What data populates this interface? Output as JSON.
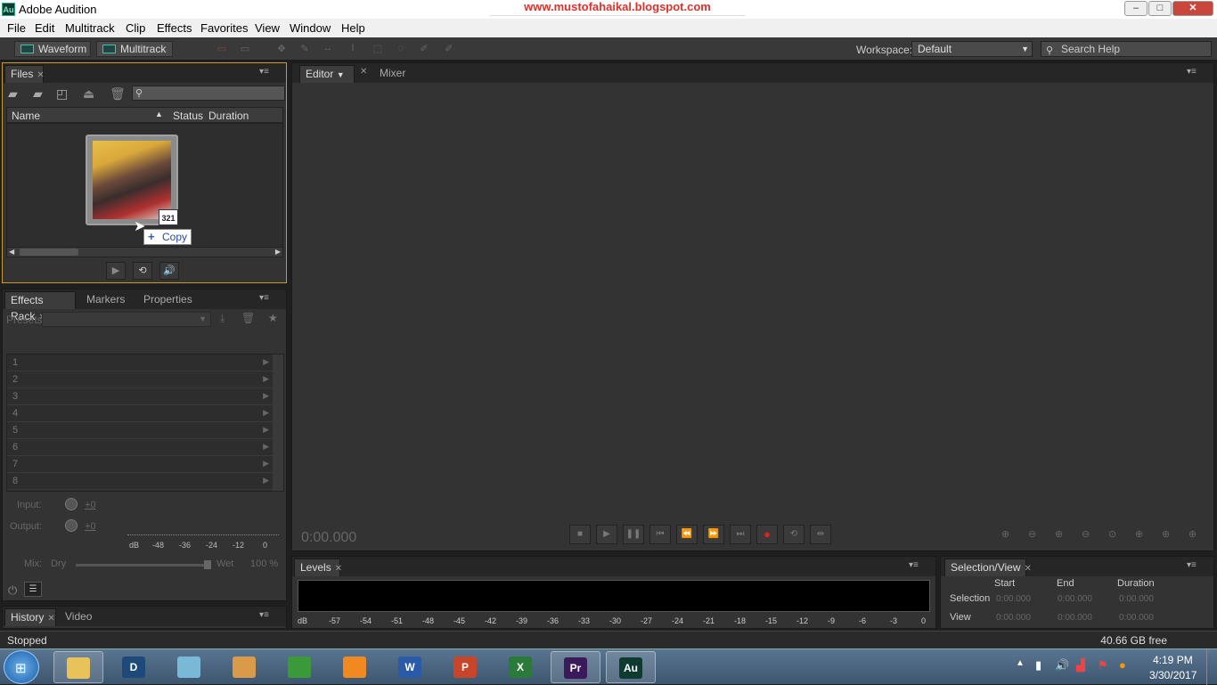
{
  "window": {
    "title": "Adobe Audition",
    "icon": "Au",
    "watermark": "www.mustofahaikal.blogspot.com",
    "controls": {
      "minimize": "–",
      "maximize": "□",
      "close": "✕"
    }
  },
  "menu": [
    "File",
    "Edit",
    "Multitrack",
    "Clip",
    "Effects",
    "Favorites",
    "View",
    "Window",
    "Help"
  ],
  "toolbar": {
    "waveform_label": "Waveform",
    "multitrack_label": "Multitrack",
    "workspace_label": "Workspace:",
    "workspace_value": "Default",
    "search_placeholder": "Search Help"
  },
  "files_panel": {
    "tab": "Files",
    "columns": [
      "Name",
      "Status",
      "Duration"
    ],
    "tooltip": "Copy",
    "thumbnail_badge": "321"
  },
  "effects_panel": {
    "tabs": [
      "Effects Rack",
      "Markers",
      "Properties"
    ],
    "presets_label": "Presets:",
    "rows": [
      "1",
      "2",
      "3",
      "4",
      "5",
      "6",
      "7",
      "8"
    ],
    "input_label": "Input:",
    "output_label": "Output:",
    "input_value": "+0",
    "output_value": "+0",
    "meter_scale": [
      "dB",
      "-48",
      "-36",
      "-24",
      "-12",
      "0"
    ],
    "mix_label": "Mix:",
    "dry_label": "Dry",
    "wet_label": "Wet",
    "wet_value": "100 %"
  },
  "history_panel": {
    "tabs": [
      "History",
      "Video"
    ]
  },
  "editor_panel": {
    "tabs": [
      "Editor",
      "Mixer"
    ],
    "time": "0:00.000"
  },
  "levels_panel": {
    "tab": "Levels",
    "scale": [
      "dB",
      "-57",
      "-54",
      "-51",
      "-48",
      "-45",
      "-42",
      "-39",
      "-36",
      "-33",
      "-30",
      "-27",
      "-24",
      "-21",
      "-18",
      "-15",
      "-12",
      "-9",
      "-6",
      "-3",
      "0"
    ]
  },
  "selection_panel": {
    "tab": "Selection/View",
    "headers": [
      "Start",
      "End",
      "Duration"
    ],
    "selection_label": "Selection",
    "view_label": "View",
    "selection_values": [
      "0:00.000",
      "0:00.000",
      "0:00.000"
    ],
    "view_values": [
      "0:00.000",
      "0:00.000",
      "0:00.000"
    ]
  },
  "status": {
    "text": "Stopped",
    "disk_free": "40.66 GB free"
  },
  "taskbar": {
    "apps": [
      {
        "name": "file-explorer",
        "label": "",
        "color": "#e8c25a"
      },
      {
        "name": "dictionary",
        "label": "D",
        "color": "#1d4a7a"
      },
      {
        "name": "notepad",
        "label": "",
        "color": "#7ab8d8"
      },
      {
        "name": "paint",
        "label": "",
        "color": "#d99a4a"
      },
      {
        "name": "chrome",
        "label": "",
        "color": "#3a9a3a"
      },
      {
        "name": "uc-browser",
        "label": "",
        "color": "#f08a20"
      },
      {
        "name": "word",
        "label": "W",
        "color": "#2a5aa8"
      },
      {
        "name": "powerpoint",
        "label": "P",
        "color": "#c9452a"
      },
      {
        "name": "excel",
        "label": "X",
        "color": "#2a7a3a"
      },
      {
        "name": "premiere",
        "label": "Pr",
        "color": "#3a1a5a"
      },
      {
        "name": "audition",
        "label": "Au",
        "color": "#0e3a32"
      }
    ],
    "time": "4:19 PM",
    "date": "3/30/2017"
  }
}
